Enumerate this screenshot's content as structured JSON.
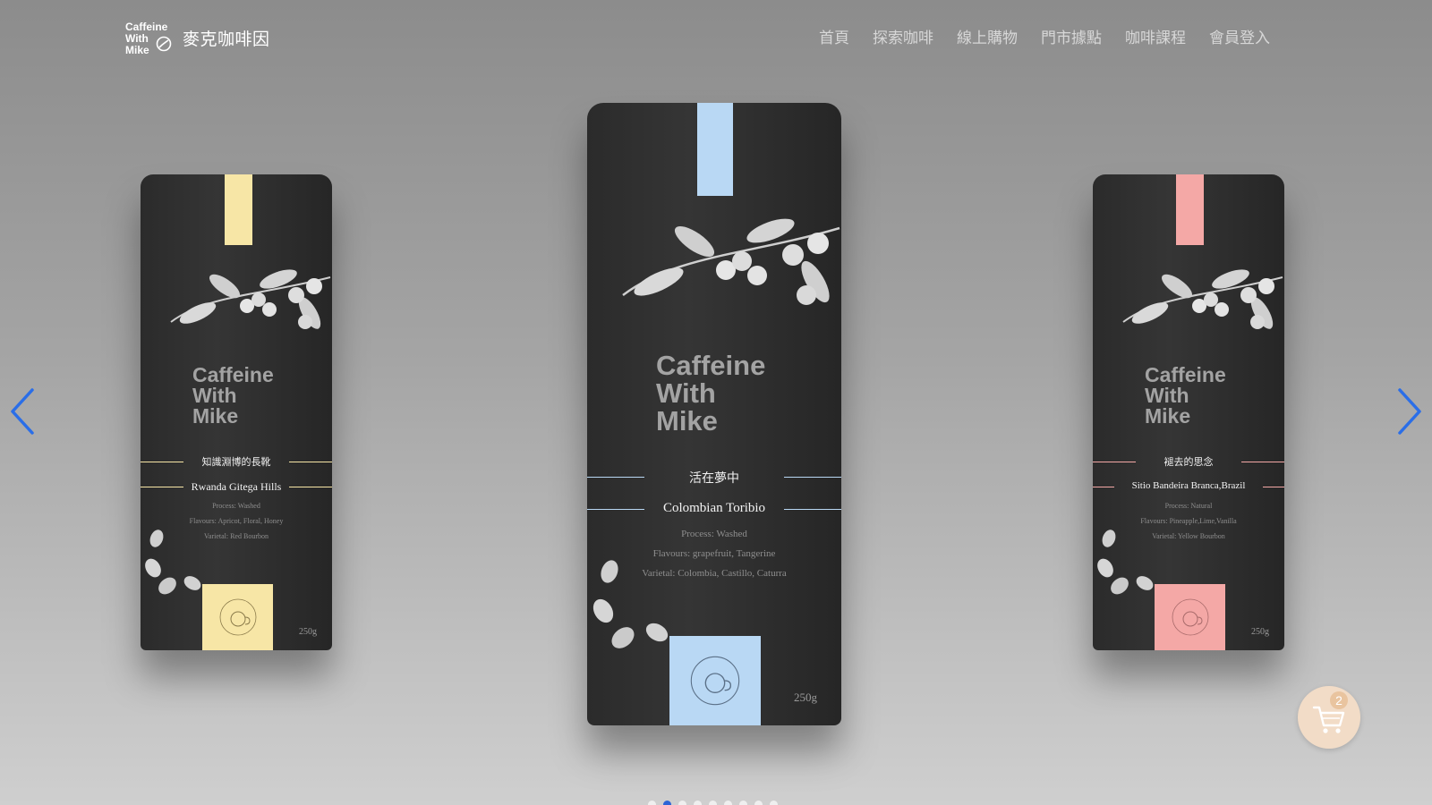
{
  "header": {
    "logo_lines": [
      "Caffeine",
      "With",
      "Mike"
    ],
    "brand_name": "麥克咖啡因",
    "nav": [
      "首頁",
      "探索咖啡",
      "線上購物",
      "門市據點",
      "咖啡課程",
      "會員登入"
    ]
  },
  "carousel": {
    "prev_icon": "chevron-left-icon",
    "next_icon": "chevron-right-icon",
    "arrow_color": "#2a6ee8",
    "slide_count": 9,
    "active_index": 1,
    "bags": [
      {
        "brand": "Caffeine\nWith\nMike",
        "cn_name": "知識淵博的長靴",
        "name": "Rwanda Gitega Hills",
        "process": "Process: Washed",
        "flavours": "Flavours: Apricot, Floral, Honey",
        "varietal": "Varietal: Red Bourbon",
        "weight": "250g",
        "accent": "#f7e6a6"
      },
      {
        "brand": "Caffeine\nWith\nMike",
        "cn_name": "活在夢中",
        "name": "Colombian Toribio",
        "process": "Process: Washed",
        "flavours": "Flavours: grapefruit, Tangerine",
        "varietal": "Varietal: Colombia, Castillo, Caturra",
        "weight": "250g",
        "accent": "#b9d8f4"
      },
      {
        "brand": "Caffeine\nWith\nMike",
        "cn_name": "褪去的思念",
        "name": "Sitio Bandeira Branca,Brazil",
        "process": "Process: Natural",
        "flavours": "Flavours: Pineapple,Lime,Vanilla",
        "varietal": "Varietal: Yellow Bourbon",
        "weight": "250g",
        "accent": "#f4a8a6"
      }
    ]
  },
  "cart": {
    "icon": "cart-icon",
    "count": "2",
    "background": "#f2dcc7",
    "badge_color": "#e9c49f"
  }
}
